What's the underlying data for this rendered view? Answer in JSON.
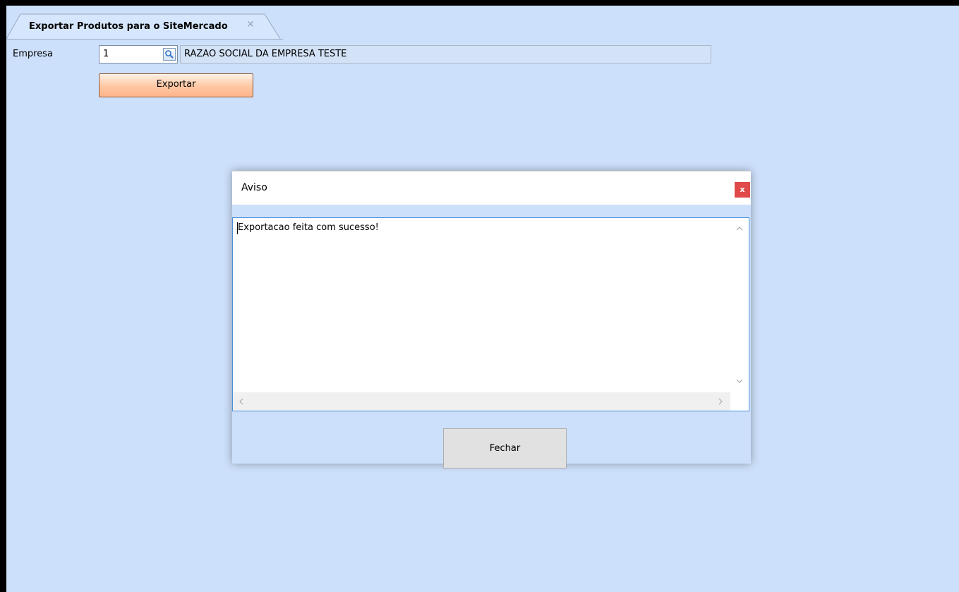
{
  "tab": {
    "title": "Exportar Produtos para o SiteMercado",
    "close_glyph": "✕"
  },
  "form": {
    "empresa_label": "Empresa",
    "empresa_code": "1",
    "empresa_name": "RAZAO SOCIAL DA EMPRESA TESTE",
    "export_label": "Exportar",
    "lookup_icon": "magnifier-icon"
  },
  "dialog": {
    "title": "Aviso",
    "close_glyph": "x",
    "message": "Exportacao feita com sucesso!",
    "close_button_label": "Fechar"
  },
  "colors": {
    "background": "#cde0fb",
    "export_button": "#ffc7a3",
    "dialog_close": "#e04a4a",
    "focus_border": "#4a90d9"
  }
}
